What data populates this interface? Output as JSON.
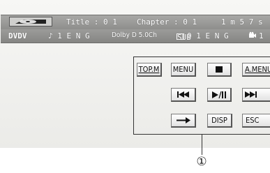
{
  "status_bar": {
    "title": "Title : 0 1",
    "chapter": "Chapter : 0 1",
    "time": "1 m 5 7 s",
    "source": "DVDV",
    "audio": "♪ 1 E N G",
    "audio_format": "Dolby D 5.0Ch",
    "subtitle_icon_text": "SUB",
    "subtitle": "0 1 E N G",
    "angle": "1"
  },
  "panel": {
    "buttons": [
      {
        "label": "TOP.M",
        "icon": null
      },
      {
        "label": "MENU",
        "icon": null
      },
      {
        "label": "",
        "icon": "stop-icon"
      },
      {
        "label": "A.MENU",
        "icon": null
      },
      {
        "label": "",
        "icon": "previous-track-icon"
      },
      {
        "label": "",
        "icon": "play-pause-icon"
      },
      {
        "label": "",
        "icon": "next-track-icon"
      },
      {
        "label": "",
        "icon": "arrow-right-icon"
      },
      {
        "label": "DISP",
        "icon": null
      },
      {
        "label": "ESC",
        "icon": null
      }
    ]
  },
  "callout": {
    "number": "①"
  }
}
